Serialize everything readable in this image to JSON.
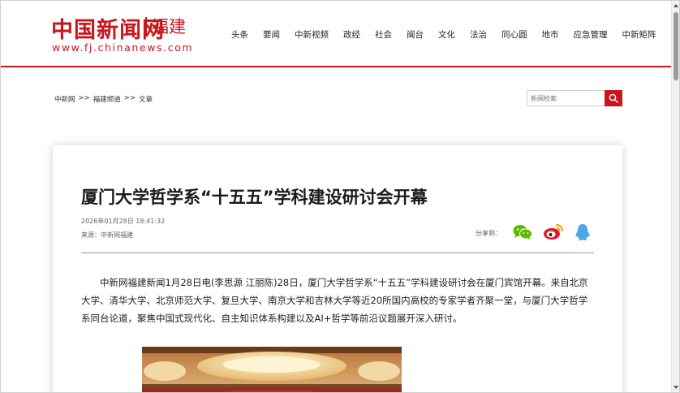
{
  "header": {
    "logo_cn": "中国新闻网",
    "logo_region": "福建",
    "logo_url": "www.fj.chinanews.com",
    "nav": [
      "头条",
      "要闻",
      "中新视频",
      "政经",
      "社会",
      "闽台",
      "文化",
      "法治",
      "同心圆",
      "地市",
      "应急管理",
      "中新矩阵"
    ]
  },
  "breadcrumb": {
    "items": [
      "中新网",
      "福建频道",
      "文章"
    ],
    "separator": ">>"
  },
  "search": {
    "placeholder": "新闻检索",
    "button_icon": "search-icon"
  },
  "article": {
    "title": "厦门大学哲学系“十五五”学科建设研讨会开幕",
    "date": "2026年01月28日 18:41:32",
    "source": "来源：中新网福建",
    "share_label": "分享到：",
    "share_icons": [
      "wechat-icon",
      "weibo-icon",
      "qq-icon"
    ],
    "body": "中新网福建新闻1月28日电(李思源 江丽陈)28日，厦门大学哲学系“十五五”学科建设研讨会在厦门宾馆开幕。来自北京大学、清华大学、北京师范大学、复旦大学、南京大学和吉林大学等近20所国内高校的专家学者齐聚一堂，与厦门大学哲学系同台论道，聚焦中国式现代化、自主知识体系构建以及AI+哲学等前沿议题展开深入研讨。"
  },
  "colors": {
    "brand_red": "#c8161d",
    "wechat_green": "#62b900",
    "weibo_red": "#e6162d",
    "qq_blue": "#4aa8e8"
  }
}
